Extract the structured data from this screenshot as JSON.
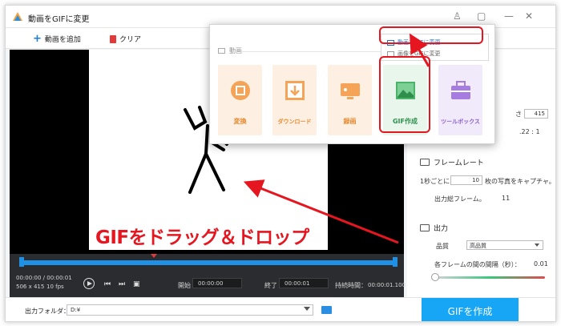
{
  "window": {
    "title": "動画をGIFに変更",
    "controls": [
      "minimize-icon",
      "maximize-icon",
      "close-icon"
    ]
  },
  "toolbar": {
    "add_video": "動画を追加",
    "clear": "クリア"
  },
  "popup": {
    "section_label": "動画",
    "tiles": [
      {
        "label": "変換",
        "icon": "film-icon",
        "color": "#f5a356"
      },
      {
        "label": "ダウンロード",
        "icon": "download-icon",
        "color": "#f5a356"
      },
      {
        "label": "録画",
        "icon": "screen-record-icon",
        "color": "#f5a356"
      },
      {
        "label": "GIF作成",
        "icon": "image-icon",
        "color": "#4cb36b"
      },
      {
        "label": "ツールボックス",
        "icon": "toolbox-icon",
        "color": "#a77ce0"
      }
    ],
    "submenu": [
      "動画をGIFに変更",
      "画像をGIFに変更"
    ]
  },
  "overlay": {
    "instruction": "GIFをドラッグ＆ドロップ"
  },
  "timeline": {
    "time_display": "00:00:00 / 00:00:01",
    "resolution": "506 x 415",
    "fps": "10 fps",
    "start_label": "開始",
    "start_value": "00:00:00",
    "end_label": "終了",
    "end_value": "00:00:01",
    "duration_label": "持続時間：",
    "duration_value": "00:00:01.100"
  },
  "right_panel": {
    "partial_letter": "さ",
    "size_value": "415",
    "ratio": ".22 : 1",
    "framerate_title": "フレームレート",
    "per_second_prefix": "1秒ごとに",
    "per_second_value": "10",
    "per_second_suffix": "枚の写真をキャプチャ。",
    "total_frames_label": "出力総フレーム。",
    "total_frames_value": "11",
    "output_title": "出力",
    "quality_label": "品質",
    "quality_value": "高品質",
    "interval_label": "各フレームの間の間隔（秒）：",
    "interval_value": "0.01"
  },
  "bottom": {
    "folder_label": "出力フォルダ：",
    "folder_value": "D:¥",
    "create_button": "GIFを作成"
  },
  "colors": {
    "accent_blue": "#17a6f5",
    "highlight_red": "#e5161f"
  }
}
